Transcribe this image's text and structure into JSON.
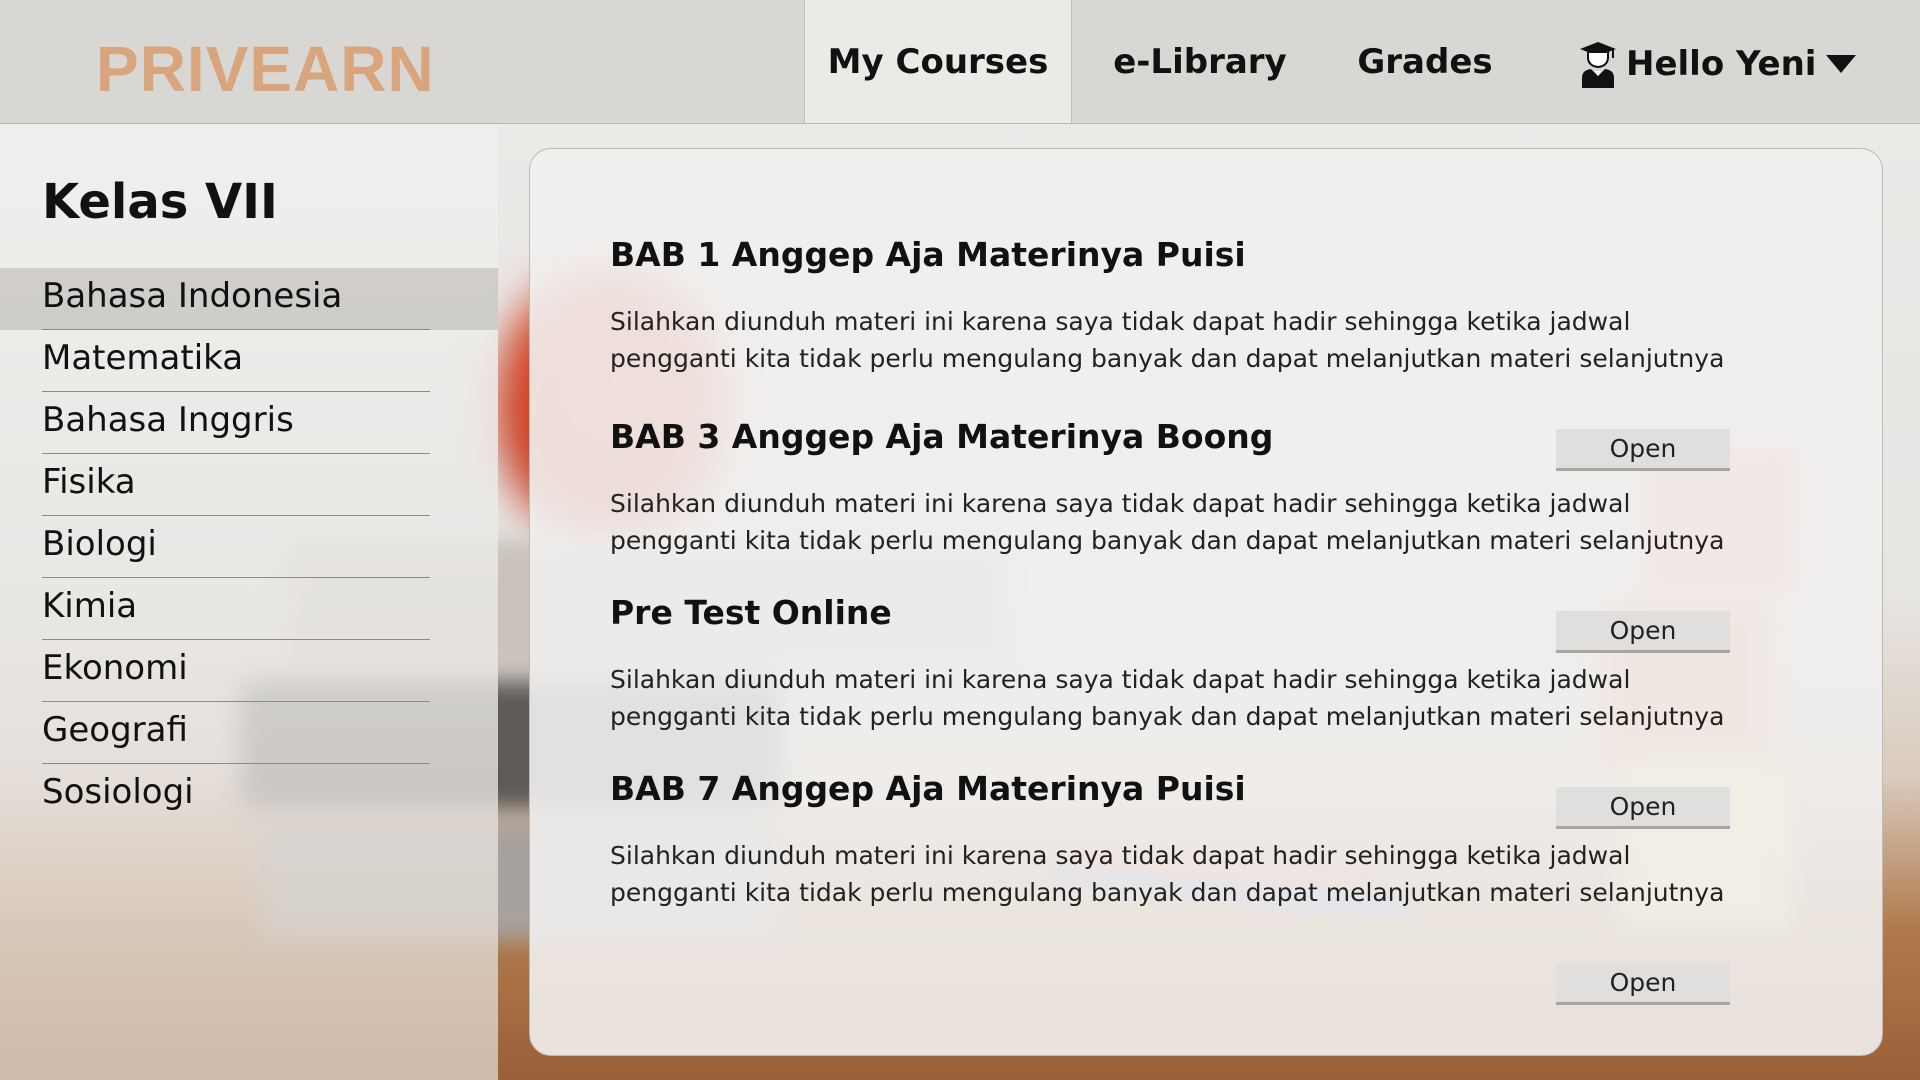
{
  "brand": {
    "logo": "PRIVEARN",
    "logo_color": "#d8a57d"
  },
  "nav": {
    "items": [
      {
        "label": "My Courses",
        "active": true
      },
      {
        "label": "e-Library",
        "active": false
      },
      {
        "label": "Grades",
        "active": false
      }
    ],
    "user": {
      "label": "Hello Yeni",
      "icon": "graduate-user-icon",
      "menu_icon": "caret-down-icon"
    }
  },
  "sidebar": {
    "title": "Kelas VII",
    "items": [
      {
        "label": "Bahasa Indonesia",
        "active": true
      },
      {
        "label": "Matematika"
      },
      {
        "label": "Bahasa Inggris"
      },
      {
        "label": "Fisika"
      },
      {
        "label": "Biologi"
      },
      {
        "label": "Kimia"
      },
      {
        "label": "Ekonomi"
      },
      {
        "label": "Geografi"
      },
      {
        "label": "Sosiologi"
      }
    ]
  },
  "main": {
    "courses": [
      {
        "title": "BAB 1 Anggep Aja Materinya Puisi",
        "description": "Silahkan diunduh materi ini karena saya tidak dapat hadir sehingga ketika jadwal pengganti kita tidak perlu mengulang banyak dan dapat melanjutkan materi selanjutnya",
        "button": "Open"
      },
      {
        "title": "BAB 3 Anggep Aja Materinya Boong",
        "description": "Silahkan diunduh materi ini karena saya tidak dapat hadir sehingga ketika jadwal pengganti kita tidak perlu mengulang banyak dan dapat melanjutkan materi selanjutnya",
        "button": "Open"
      },
      {
        "title": "Pre Test Online",
        "description": "Silahkan diunduh materi ini karena saya tidak dapat hadir sehingga ketika jadwal pengganti kita tidak perlu mengulang banyak dan dapat melanjutkan materi selanjutnya",
        "button": "Open"
      },
      {
        "title": "BAB 7 Anggep Aja Materinya Puisi",
        "description": "Silahkan diunduh materi ini karena saya tidak dapat hadir sehingga ketika jadwal pengganti kita tidak perlu mengulang banyak dan dapat melanjutkan materi selanjutnya",
        "button": "Open"
      }
    ]
  }
}
